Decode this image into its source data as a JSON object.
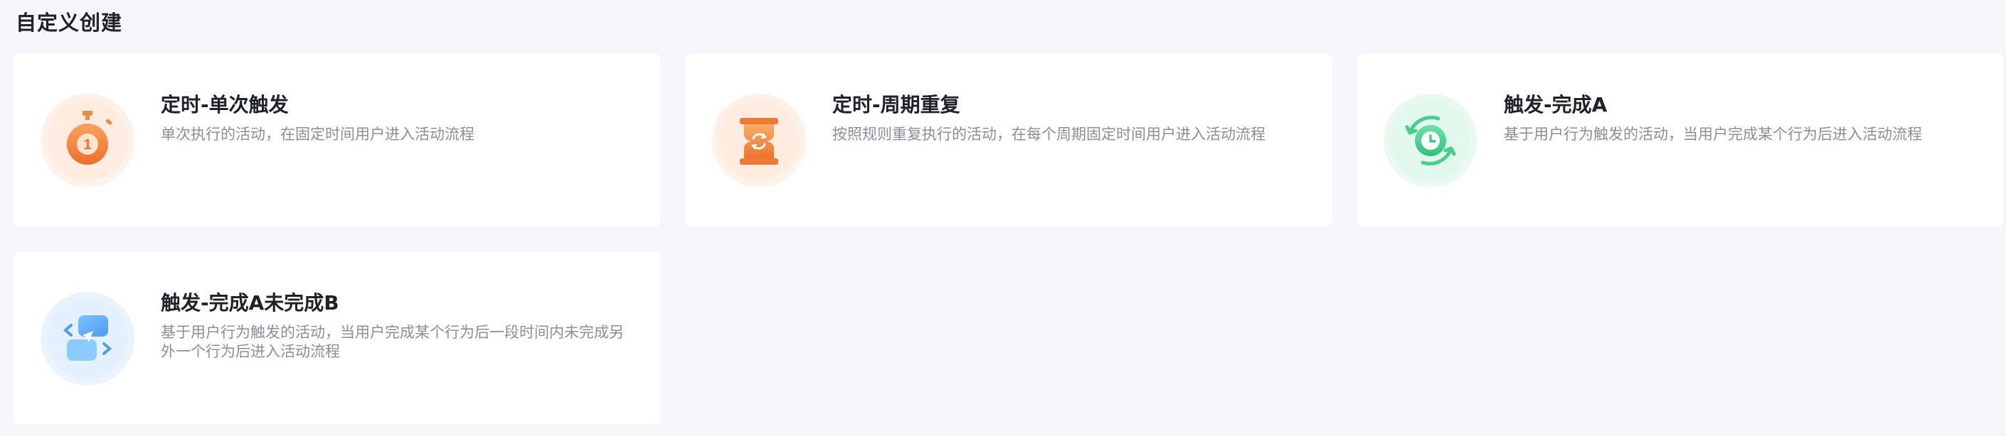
{
  "section": {
    "title": "自定义创建"
  },
  "cards": [
    {
      "title": "定时-单次触发",
      "description": "单次执行的活动，在固定时间用户进入活动流程",
      "icon": "stopwatch-icon",
      "accent": "#f4873f"
    },
    {
      "title": "定时-周期重复",
      "description": "按照规则重复执行的活动，在每个周期固定时间用户进入活动流程",
      "icon": "hourglass-repeat-icon",
      "accent": "#f08a3c"
    },
    {
      "title": "触发-完成A",
      "description": "基于用户行为触发的活动，当用户完成某个行为后进入活动流程",
      "icon": "clock-cycle-icon",
      "accent": "#3ccf87"
    },
    {
      "title": "触发-完成A未完成B",
      "description": "基于用户行为触发的活动，当用户完成某个行为后一段时间内未完成另外一个行为后进入活动流程",
      "icon": "message-switch-icon",
      "accent": "#5aa8f5"
    }
  ]
}
